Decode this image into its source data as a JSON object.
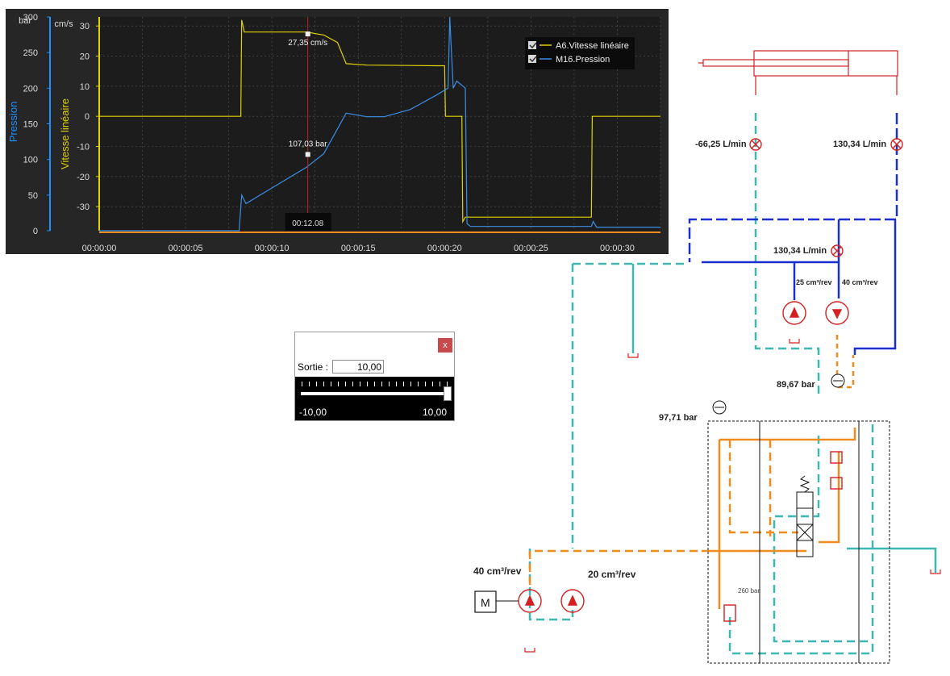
{
  "chart_data": {
    "type": "line",
    "x_axis": {
      "ticks": [
        "00:00:00",
        "00:00:05",
        "00:00:10",
        "00:00:15",
        "00:00:20",
        "00:00:25",
        "00:00:30"
      ],
      "range_seconds": [
        0,
        32.5
      ]
    },
    "y_axes": [
      {
        "side": "left-outer",
        "label": "Pression",
        "unit": "bar",
        "range": [
          0,
          300
        ],
        "ticks": [
          "0",
          "50",
          "100",
          "150",
          "200",
          "250",
          "300"
        ],
        "color": "#1e90ff"
      },
      {
        "side": "left-inner",
        "label": "Vitesse linéaire",
        "unit": "cm/s",
        "range": [
          -38,
          33
        ],
        "ticks": [
          "-30",
          "-20",
          "-10",
          "0",
          "10",
          "20",
          "30"
        ],
        "color": "#e0d200"
      }
    ],
    "series": [
      {
        "name": "A6.Vitesse linéaire",
        "color": "#e0d200",
        "axis": "cm/s",
        "points": [
          [
            0,
            0
          ],
          [
            8.2,
            0
          ],
          [
            8.25,
            32
          ],
          [
            8.4,
            28
          ],
          [
            12,
            28
          ],
          [
            13,
            27
          ],
          [
            13.8,
            24.5
          ],
          [
            14.3,
            17.5
          ],
          [
            15.5,
            17
          ],
          [
            19.5,
            16.8
          ],
          [
            20,
            16.8
          ],
          [
            20.05,
            0
          ],
          [
            21.0,
            0
          ],
          [
            21.05,
            -35
          ],
          [
            21.2,
            -33.5
          ],
          [
            28.5,
            -33.5
          ],
          [
            28.55,
            0
          ],
          [
            32.5,
            0
          ]
        ]
      },
      {
        "name": "M16.Pression",
        "color": "#3a8ee6",
        "axis": "bar",
        "points": [
          [
            0,
            0
          ],
          [
            8.1,
            0
          ],
          [
            8.25,
            50
          ],
          [
            8.5,
            38
          ],
          [
            10,
            60
          ],
          [
            12,
            89
          ],
          [
            13,
            108
          ],
          [
            14.3,
            165
          ],
          [
            15.5,
            160
          ],
          [
            16.5,
            160
          ],
          [
            18,
            170
          ],
          [
            19.5,
            190
          ],
          [
            20.2,
            200
          ],
          [
            20.3,
            300
          ],
          [
            20.5,
            200
          ],
          [
            20.7,
            210
          ],
          [
            21.2,
            200
          ],
          [
            21.3,
            10
          ],
          [
            21.5,
            6
          ],
          [
            28.5,
            6
          ],
          [
            28.6,
            13
          ],
          [
            28.8,
            5
          ],
          [
            32.5,
            5
          ]
        ]
      }
    ],
    "cursor": {
      "time": "00:12.08",
      "t_seconds": 12.08
    },
    "annotations": [
      {
        "text": "27,35 cm/s",
        "series": "A6.Vitesse linéaire",
        "t": 12.08,
        "value": 27.35
      },
      {
        "text": "107,03 bar",
        "series": "M16.Pression",
        "t": 12.08,
        "value": 107.03
      }
    ],
    "legend": {
      "placement": "top-right",
      "items": [
        "A6.Vitesse linéaire",
        "M16.Pression"
      ]
    }
  },
  "slider": {
    "output_label": "Sortie :",
    "output_value": "10,00",
    "min_label": "-10,00",
    "max_label": "10,00",
    "position_fraction": 1.0,
    "close_label": "x"
  },
  "schematic": {
    "labels": {
      "flow_left": "-66,25 L/min",
      "flow_right": "130,34 L/min",
      "flow_mid": "130,34 L/min",
      "disp_a": "25 cm³/rev",
      "disp_b": "40 cm³/rev",
      "press_a": "89,67 bar",
      "press_b": "97,71 bar",
      "relief": "260 bar",
      "pump1_disp": "40 cm³/rev",
      "pump2_disp": "20 cm³/rev",
      "motor": "M"
    },
    "colors": {
      "orange": "#f08c1e",
      "teal": "#3cb8b0",
      "blue": "#1a2fcf",
      "red": "#d42020"
    }
  }
}
